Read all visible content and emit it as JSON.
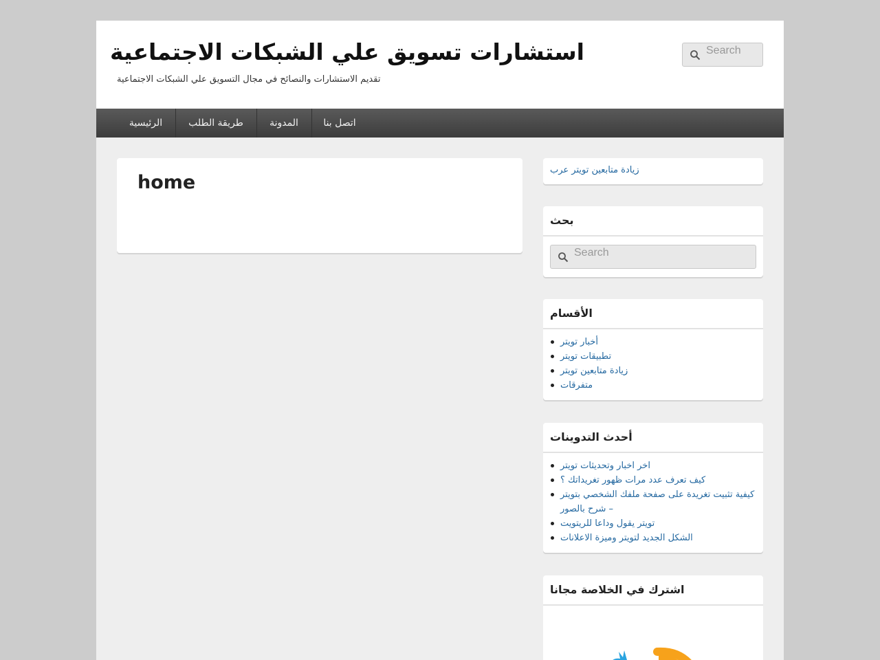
{
  "header": {
    "site_title": "استشارات تسويق علي الشبكات الاجتماعية",
    "site_description": "تقديم الاستشارات والنصائح في مجال التسويق علي الشبكات الاجتماعية",
    "search_placeholder": "Search"
  },
  "nav": {
    "items": [
      {
        "label": "الرئيسية"
      },
      {
        "label": "طريقة الطلب"
      },
      {
        "label": "المدونة"
      },
      {
        "label": "اتصل بنا"
      }
    ]
  },
  "main": {
    "title": "home"
  },
  "sidebar": {
    "top_link": "زيادة متابعين تويتر عرب",
    "search_widget": {
      "title": "بحث",
      "placeholder": "Search"
    },
    "categories_widget": {
      "title": "الأقسام",
      "items": [
        "أخبار تويتر",
        "تطبيقات تويتر",
        "زيادة متابعين تويتر",
        "متفرقات"
      ]
    },
    "recent_posts_widget": {
      "title": "أحدث التدوينات",
      "items": [
        "اخر اخبار وتحديثات تويتر",
        "كيف تعرف عدد مرات ظهور تغريداتك ؟",
        "كيفية تثبيت تغريدة على صفحة ملفك الشخصي بتويتر – شرح بالصور",
        "تويتر يقول وداعا للريتويت",
        "الشكل الجديد لتويتر وميزة الاعلانات"
      ]
    },
    "subscribe_widget": {
      "title": "اشترك في الخلاصة مجانا"
    }
  },
  "colors": {
    "page_bg": "#cccccc",
    "nav_bg": "#4a4a4a",
    "link": "#2468a0",
    "rss_orange": "#f7a21b",
    "bird_blue": "#2aa4e0"
  }
}
